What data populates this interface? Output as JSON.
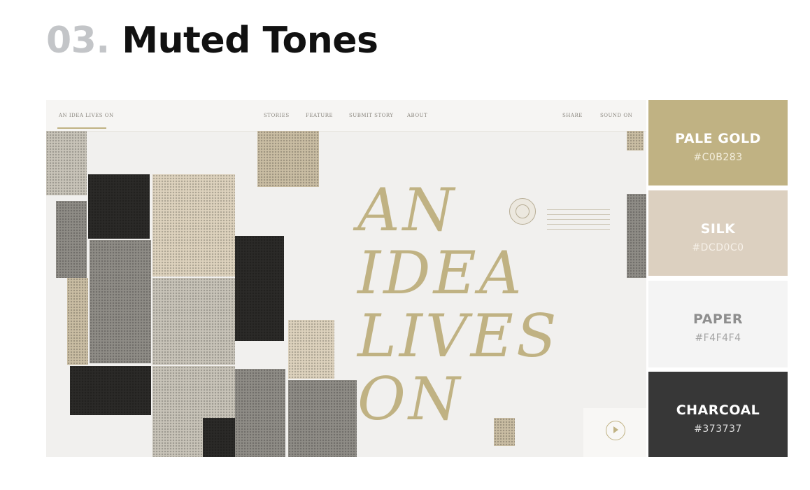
{
  "heading": {
    "number": "03.",
    "title": "Muted Tones"
  },
  "mockup": {
    "nav": {
      "brand": "AN IDEA LIVES ON",
      "links": [
        "STORIES",
        "FEATURE",
        "SUBMIT STORY",
        "ABOUT"
      ],
      "right": [
        "SHARE",
        "SOUND ON"
      ]
    },
    "hero_words": [
      "AN",
      "IDEA",
      "LIVES",
      "ON"
    ],
    "play_icon": "play-circle-icon"
  },
  "palette": [
    {
      "name": "PALE GOLD",
      "hex": "#C0B283",
      "color": "#C0B283",
      "text_color": "#ffffff",
      "hex_color": "#f3eedd"
    },
    {
      "name": "SILK",
      "hex": "#DCD0C0",
      "color": "#DCD0C0",
      "text_color": "#ffffff",
      "hex_color": "#f6f0e8"
    },
    {
      "name": "PAPER",
      "hex": "#F4F4F4",
      "color": "#F4F4F4",
      "text_color": "#8e8e8e",
      "hex_color": "#a5a5a5"
    },
    {
      "name": "CHARCOAL",
      "hex": "#373737",
      "color": "#373737",
      "text_color": "#ffffff",
      "hex_color": "#dcdcdc"
    }
  ]
}
